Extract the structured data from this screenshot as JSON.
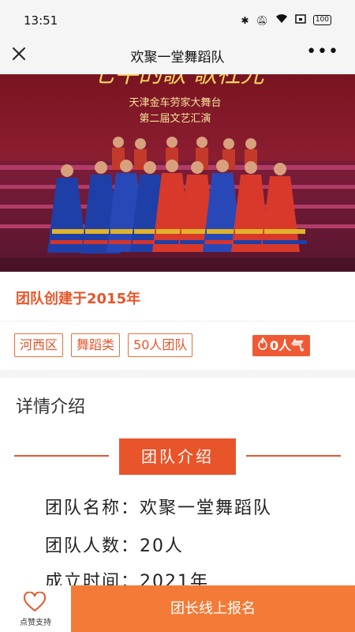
{
  "status_bar": {
    "time": "13:51",
    "battery": "100"
  },
  "nav": {
    "title": "欢聚一堂舞蹈队",
    "more": "•••"
  },
  "hero": {
    "banner_line1": "天津金车劳家大舞台",
    "banner_line2": "第二届文艺汇演"
  },
  "team": {
    "created_text": "团队创建于2015年",
    "tags": [
      "河西区",
      "舞蹈类",
      "50人团队"
    ],
    "popularity": "0人气"
  },
  "details": {
    "section_title": "详情介绍",
    "banner": "团队介绍",
    "rows": [
      {
        "label": "团队名称：",
        "value": "欢聚一堂舞蹈队"
      },
      {
        "label": "团队人数：",
        "value": "20人"
      },
      {
        "label": "成立时间：",
        "value": "2021年"
      }
    ]
  },
  "footer": {
    "like_label": "点赞支持",
    "signup_label": "团长线上报名"
  },
  "colors": {
    "accent": "#e8552a",
    "button": "#f37b37"
  }
}
